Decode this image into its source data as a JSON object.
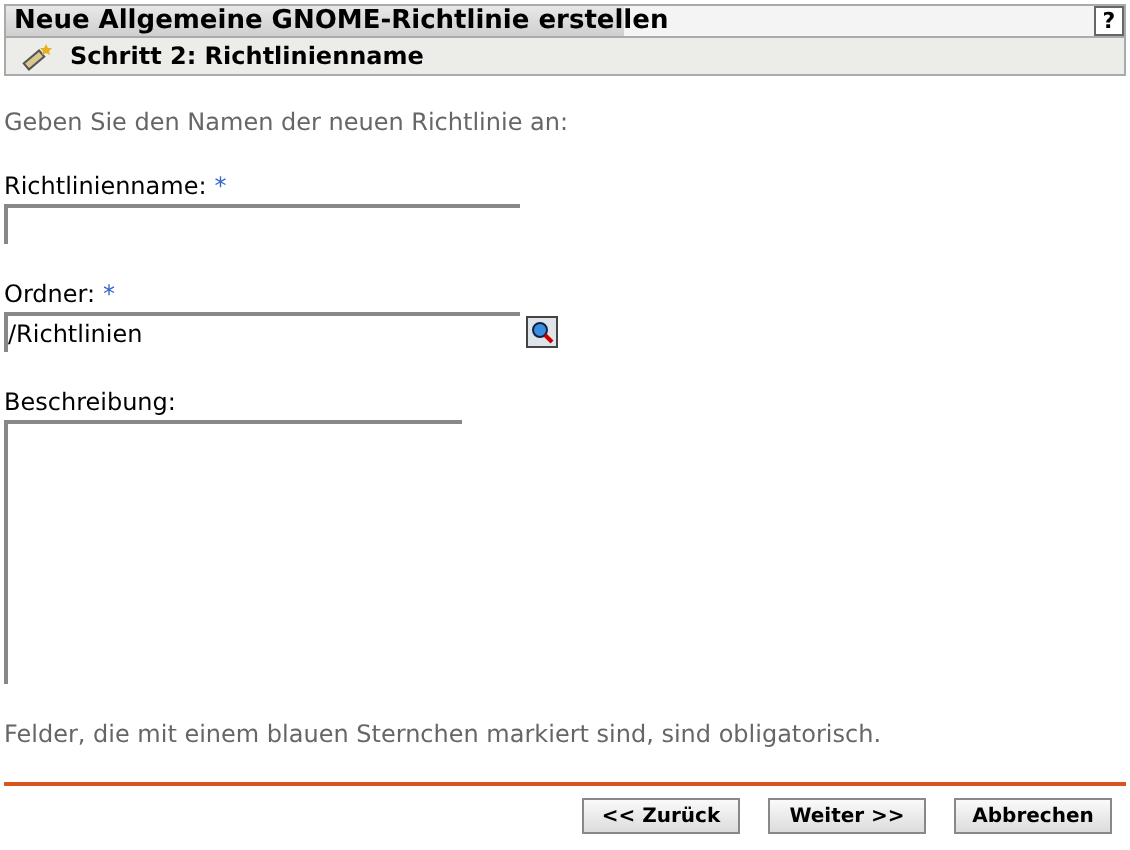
{
  "window": {
    "title": "Neue Allgemeine GNOME-Richtlinie erstellen",
    "help": "?"
  },
  "step": {
    "title": "Schritt 2: Richtlinienname"
  },
  "intro": "Geben Sie den Namen der neuen Richtlinie an:",
  "fields": [
    {
      "kind": "text",
      "label": "Richtlinienname:",
      "required": true,
      "browse": false
    },
    {
      "kind": "text",
      "label": "Ordner:",
      "required": true,
      "value": "/Richtlinien",
      "browse": true
    },
    {
      "kind": "textarea",
      "label": "Beschreibung:",
      "required": false,
      "browse": false
    }
  ],
  "required_mark": "*",
  "note": "Felder, die mit einem blauen Sternchen markiert sind, sind obligatorisch.",
  "buttons": [
    "<< Zurück",
    "Weiter >>",
    "Abbrechen"
  ]
}
